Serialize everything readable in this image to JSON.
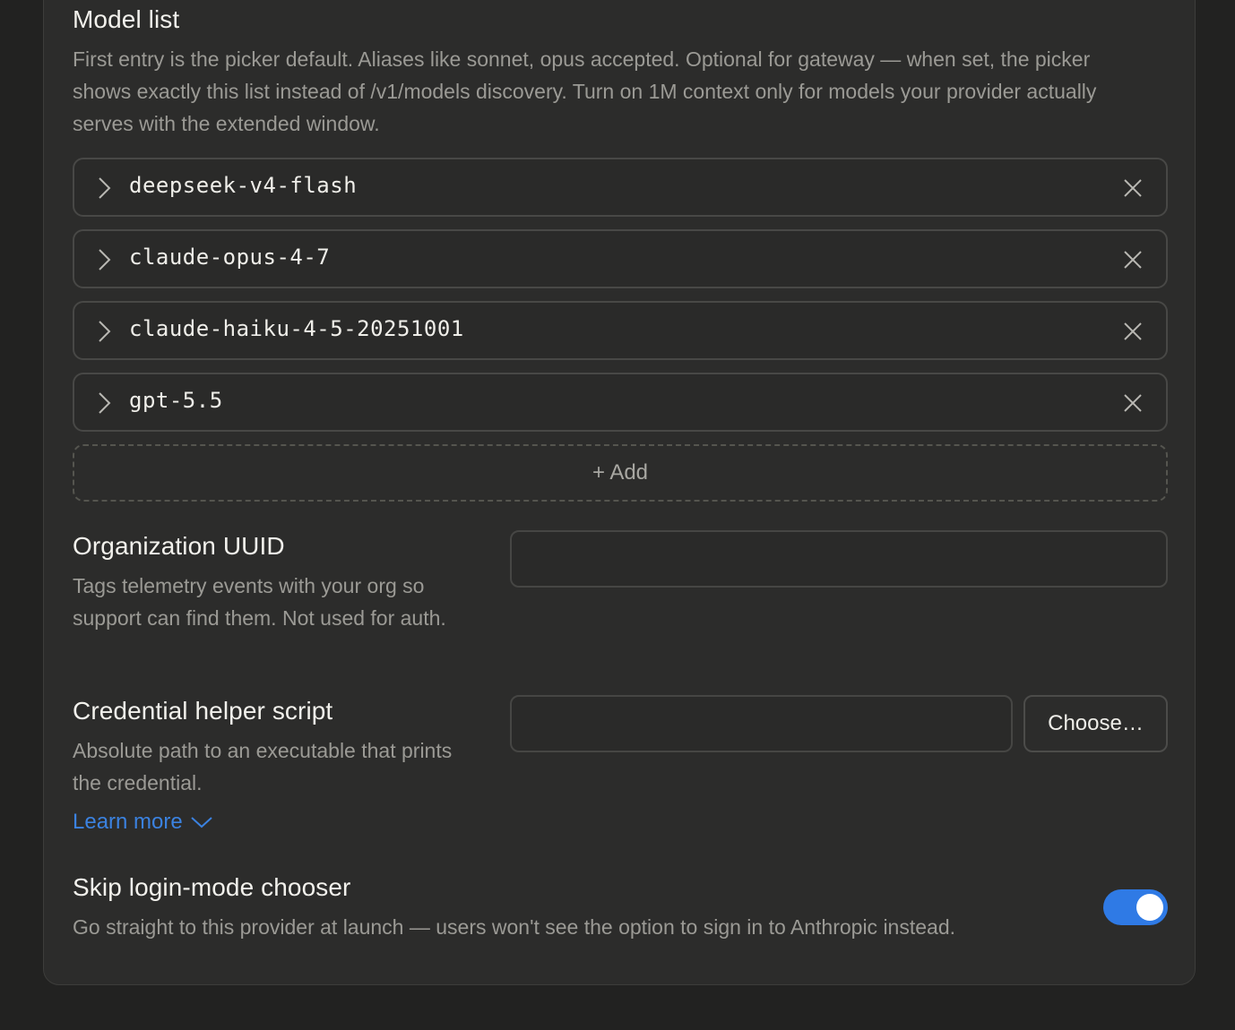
{
  "model_list": {
    "title": "Model list",
    "description": "First entry is the picker default. Aliases like sonnet, opus accepted. Optional for gateway — when set, the picker shows exactly this list instead of /v1/models discovery. Turn on 1M context only for models your provider actually serves with the extended window.",
    "items": [
      {
        "name": "deepseek-v4-flash"
      },
      {
        "name": "claude-opus-4-7"
      },
      {
        "name": "claude-haiku-4-5-20251001"
      },
      {
        "name": "gpt-5.5"
      }
    ],
    "add_label": "+ Add"
  },
  "org_uuid": {
    "title": "Organization UUID",
    "description": "Tags telemetry events with your org so support can find them. Not used for auth.",
    "value": ""
  },
  "credential_helper": {
    "title": "Credential helper script",
    "description": "Absolute path to an executable that prints the credential.",
    "value": "",
    "choose_label": "Choose…",
    "learn_more_label": "Learn more"
  },
  "skip_login": {
    "title": "Skip login-mode chooser",
    "description": "Go straight to this provider at launch — users won't see the option to sign in to Anthropic instead.",
    "enabled": true
  },
  "colors": {
    "accent": "#2f7ae5",
    "link": "#3b82e0",
    "background": "#222221",
    "card": "#2c2c2b"
  },
  "icons": {
    "row_expand": "chevron-right-icon",
    "row_remove": "close-icon",
    "learn_more": "chevron-down-icon"
  }
}
